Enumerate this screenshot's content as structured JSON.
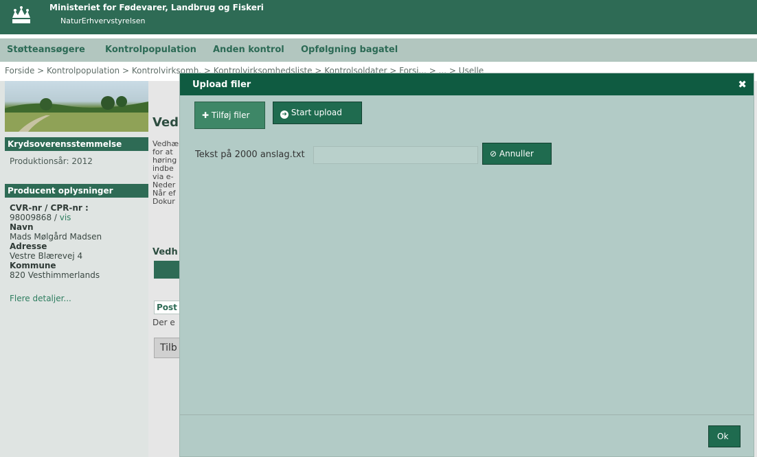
{
  "header": {
    "ministry": "Ministeriet for Fødevarer, Landbrug og Fiskeri",
    "agency": "NaturErhvervstyrelsen"
  },
  "nav": [
    "Støtteansøgere",
    "Kontrolpopulation",
    "Anden kontrol",
    "Opfølgning bagatel"
  ],
  "breadcrumb": {
    "text": "Forside > Kontrolpopulation > Kontrolvirksomh. > Kontrolvirksomhedsliste > Kontrolsoldater > Forsi... > ... > Uselle"
  },
  "sidebar": {
    "section1_title": "Krydsoverensstemmelse",
    "year": "Produktionsår: 2012",
    "section2_title": "Producent oplysninger",
    "cvr_label": "CVR-nr / CPR-nr :",
    "cvr_value": "98009868 / ",
    "cvr_link": "vis",
    "name_label": "Navn",
    "name_value": "Mads Mølgård Madsen",
    "address_label": "Adresse",
    "address_value": "Vestre Blærevej 4",
    "municipality_label": "Kommune",
    "municipality_value": "820 Vesthimmerlands",
    "more_link": "Flere detaljer..."
  },
  "content": {
    "title": "Vedl",
    "lines": [
      "Vedhæ",
      "for at",
      "høring",
      "indbe",
      "via e-",
      "Neder",
      "Når ef",
      "Dokur"
    ],
    "subtitle": "Vedh",
    "post": "Post",
    "der": "Der e",
    "tilb": "Tilb"
  },
  "modal": {
    "title": "Upload filer",
    "close": "✖",
    "add_files": "Tilføj filer",
    "start_upload": "Start upload",
    "file_name": "Tekst på 2000 anslag.txt",
    "cancel": "Annuller",
    "ok": "Ok"
  },
  "colors": {
    "topbar": "#2e6b55",
    "navbar": "#b2c6bf",
    "modal_bg": "#b2cbc6",
    "modal_header": "#0f5b41"
  }
}
